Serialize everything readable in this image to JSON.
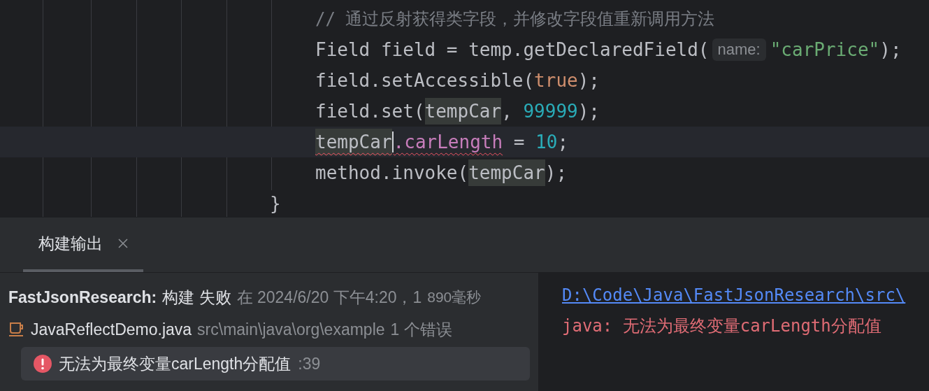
{
  "editor": {
    "body_lines": [
      {
        "current": false,
        "tokens": [
          {
            "kind": "comment",
            "text": "// 通过反射获得类字段，并修改字段值重新调用方法"
          }
        ]
      },
      {
        "current": false,
        "tokens": [
          {
            "kind": "plain",
            "text": "Field field = temp.getDeclaredField("
          },
          {
            "kind": "hint",
            "text": "name:"
          },
          {
            "kind": "string",
            "text": "\"carPrice\""
          },
          {
            "kind": "plain",
            "text": ");"
          }
        ]
      },
      {
        "current": false,
        "tokens": [
          {
            "kind": "plain",
            "text": "field.setAccessible("
          },
          {
            "kind": "keyword",
            "text": "true"
          },
          {
            "kind": "plain",
            "text": ");"
          }
        ]
      },
      {
        "current": false,
        "tokens": [
          {
            "kind": "plain",
            "text": "field.set("
          },
          {
            "kind": "usage",
            "text": "tempCar"
          },
          {
            "kind": "plain",
            "text": ", "
          },
          {
            "kind": "number",
            "text": "99999"
          },
          {
            "kind": "plain",
            "text": ");"
          }
        ]
      },
      {
        "current": true,
        "tokens": [
          {
            "kind": "usage",
            "text": "tempCar",
            "error": true,
            "caret": true
          },
          {
            "kind": "field",
            "text": ".carLength",
            "error": true
          },
          {
            "kind": "plain",
            "text": " = "
          },
          {
            "kind": "number",
            "text": "10"
          },
          {
            "kind": "plain",
            "text": ";"
          }
        ]
      },
      {
        "current": false,
        "tokens": [
          {
            "kind": "plain",
            "text": "method.invoke("
          },
          {
            "kind": "usage",
            "text": "tempCar"
          },
          {
            "kind": "plain",
            "text": ");"
          }
        ]
      }
    ],
    "closing_line": {
      "current": false,
      "tokens": [
        {
          "kind": "plain",
          "text": "}"
        }
      ]
    }
  },
  "build_panel": {
    "tabs": [
      {
        "label": "构建输出",
        "selected": true,
        "closable": true
      }
    ],
    "summary": {
      "project": "FastJsonResearch:",
      "result": "构建 失败",
      "time": "在 2024/6/20 下午4:20，1",
      "duration": "890毫秒"
    },
    "file": {
      "name": "JavaReflectDemo.java",
      "path": "src\\main\\java\\org\\example",
      "count": "1 个错误"
    },
    "errors": [
      {
        "message": "无法为最终变量carLength分配值",
        "line": ":39",
        "selected": true
      }
    ],
    "console": {
      "link": "D:\\Code\\Java\\FastJsonResearch\\src\\",
      "message": "java: 无法为最终变量carLength分配值"
    }
  }
}
